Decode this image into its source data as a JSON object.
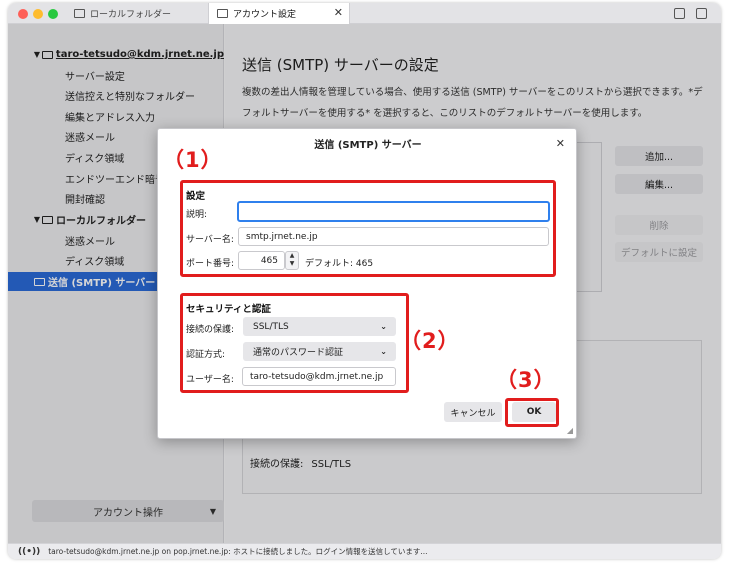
{
  "colors": {
    "accent": "#2a6ad8",
    "annotation": "#e11d1d",
    "close_dot": "#fe5f57",
    "min_dot": "#febc2e",
    "max_dot": "#28c840"
  },
  "tabs": [
    {
      "label": "ローカルフォルダー",
      "icon": "folder-icon"
    },
    {
      "label": "アカウント設定",
      "icon": "settings-icon",
      "close": "✕"
    }
  ],
  "sidebar": {
    "account": "taro-tetsudo@kdm.jrnet.ne.jp",
    "account_items": [
      "サーバー設定",
      "送信控えと特別なフォルダー",
      "編集とアドレス入力",
      "迷惑メール",
      "ディスク領域",
      "エンドツーエンド暗号化",
      "開封確認"
    ],
    "local_folder": "ローカルフォルダー",
    "local_items": [
      "迷惑メール",
      "ディスク領域"
    ],
    "smtp_item": "送信 (SMTP) サーバー",
    "account_actions": "アカウント操作"
  },
  "main": {
    "title": "送信 (SMTP) サーバーの設定",
    "description": "複数の差出人情報を管理している場合、使用する送信 (SMTP) サーバーをこのリストから選択できます。*デフォルトサーバーを使用する* を選択すると、このリストのデフォルトサーバーを使用します。",
    "buttons": {
      "add": "追加...",
      "edit": "編集...",
      "delete": "削除",
      "set_default": "デフォルトに設定"
    },
    "details_label": "接続の保護:",
    "details_value": "SSL/TLS"
  },
  "dialog": {
    "title": "送信 (SMTP) サーバー",
    "close": "✕",
    "settings_group": "設定",
    "description_label": "説明:",
    "description_value": "",
    "server_label": "サーバー名:",
    "server_value": "smtp.jrnet.ne.jp",
    "port_label": "ポート番号:",
    "port_value": "465",
    "default_text": "デフォルト: 465",
    "security_group": "セキュリティと認証",
    "connection_label": "接続の保護:",
    "connection_value": "SSL/TLS",
    "auth_label": "認証方式:",
    "auth_value": "通常のパスワード認証",
    "username_label": "ユーザー名:",
    "username_value": "taro-tetsudo@kdm.jrnet.ne.jp",
    "cancel": "キャンセル",
    "ok": "OK"
  },
  "annotations": [
    "（1）",
    "（2）",
    "（3）"
  ],
  "status": "taro-tetsudo@kdm.jrnet.ne.jp on pop.jrnet.ne.jp: ホストに接続しました。ログイン情報を送信しています..."
}
